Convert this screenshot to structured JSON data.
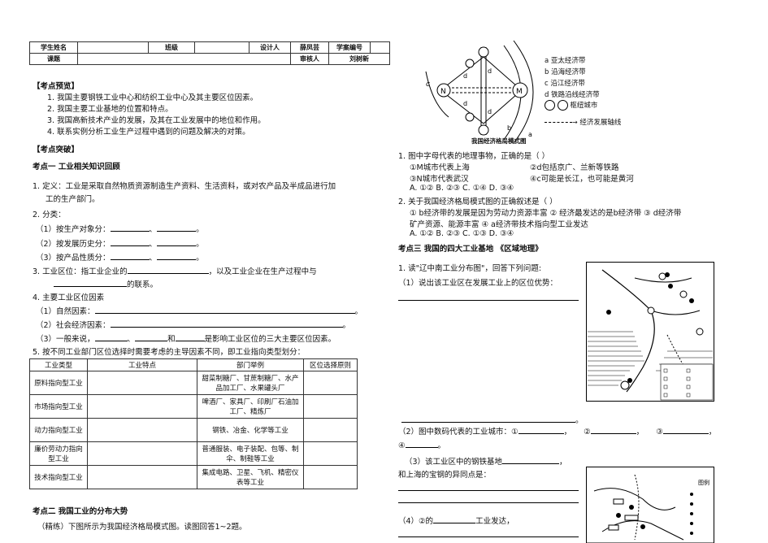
{
  "header": {
    "student_name": "学生姓名",
    "class": "班级",
    "designer": "设计人",
    "designer_name": "薛凤芸",
    "plan_no": "学案编号",
    "topic": "课题",
    "reviewer": "审核人",
    "reviewer_name": "刘树新"
  },
  "preview": {
    "title": "【考点预览】",
    "items": [
      "1. 我国主要钢铁工业中心和纺织工业中心及其主要区位因素。",
      "2. 我国主要工业基地的位置和特点。",
      "3. 我国高新技术产业的发展，及其在工业发展中的地位和作用。",
      "4. 联系实例分析工业生产过程中遇到的问题及解决的对策。"
    ]
  },
  "breakthrough": {
    "title": "【考点突破】"
  },
  "point1": {
    "title": "考点一  工业相关知识回顾",
    "def": "1. 定义：工业是采取自然物质资源制造生产资料、生活资料，或对农产品及半成品进行加",
    "def2": "工的生产部门。",
    "cls": "2. 分类：",
    "cls1": "（1）按生产对象分：",
    "cls2": "（2）按发展历史分：",
    "cls3": "（3）按产品性质分：",
    "sep": "、",
    "end": "。",
    "loc": "3. 工业区位：指工业企业的",
    "loc_mid": "，以及工业企业在生产过程中与",
    "loc2": "的联系。",
    "factors": "4. 主要工业区位因素",
    "f1": "（1）自然因素：",
    "f2": "（2）社会经济因素：",
    "f3a": "（3）一般来说，",
    "f3b": "和",
    "f3c": "是影响工业区位的三大主要区位因素。",
    "p5": "5. 按不同工业部门区位选择时需要考虑的主导因素不同，即工业指向类型划分："
  },
  "industry_table": {
    "headers": [
      "工业类型",
      "工业特点",
      "部门举例",
      "区位选择原则"
    ],
    "rows": [
      {
        "type": "原料指向型工业",
        "example": "甜菜制糖厂、甘蔗制糖厂、水产品加工厂、水果罐头厂"
      },
      {
        "type": "市场指向型工业",
        "example": "啤酒厂、家具厂、印刷厂石油加工厂、精炼厂"
      },
      {
        "type": "动力指向型工业",
        "example": "钢铁、冶金、化学等工业"
      },
      {
        "type": "廉价劳动力指向型工业",
        "example": "普通服装、电子装配、包等、制伞、制鞋等工业"
      },
      {
        "type": "技术指向型工业",
        "example": "集成电路、卫星、飞机、精密仪表等工业"
      }
    ]
  },
  "point2": {
    "title": "考点二  我国工业的分布大势",
    "practice": "（精练）下图所示为我国经济格局模式图。读图回答1~2题。"
  },
  "diagram": {
    "caption": "我国经济格局模式图",
    "labels": {
      "a": "a",
      "b": "b",
      "c": "c",
      "d": "d",
      "N": "N",
      "M": "M"
    },
    "legend": [
      "a 亚太经济带",
      "b 沿海经济带",
      "c 沿江经济带",
      "d 铁路沿线经济带",
      "枢纽城市",
      "经济发展轴线"
    ]
  },
  "questions": {
    "q1": "1. 图中字母代表的地理事物，正确的是（     ）",
    "q1_o1": "①M城市代表上海",
    "q1_o2": "②d包括京广、兰新等铁路",
    "q1_o3": "③N城市代表武汉",
    "q1_o4": "④c可能是长江，也可能是黄河",
    "q1_ans": "A. ①②        B. ②③        C. ①④        D. ③④",
    "q2": "2. 关于我国经济格局模式图的正确叙述是（     ）",
    "q2_o1": "①  b经济带的发展是因为劳动力资源丰富    ②  经济最发达的是b经济带    ③  d经济带",
    "q2_o1b": "矿产资源、能源丰富    ④  a经济带技术指向型工业发达",
    "q2_ans": "A. ①②        B. ②③        C. ①③        D. ③④"
  },
  "point3": {
    "title": "考点三   我国的四大工业基地    《区域地理》",
    "q1": "1. 读\"辽中南工业分布图\"，回答下列问题:",
    "q1_1": "（1）说出该工业区在发展工业上的区位优势：",
    "q1_2a": "（2）图中数码代表的工业城市：①",
    "q1_2b": "②",
    "q1_2c": "③",
    "q1_2d": "④",
    "q1_3a": "（3）该工业区中的钢铁基地",
    "q1_3b": "和上海的宝钢的异同点是：",
    "q1_4a": "（4）②的",
    "q1_4b": "工业发达，",
    "dot": "。",
    "comma": "，",
    "map2_legend_title": "图例"
  }
}
